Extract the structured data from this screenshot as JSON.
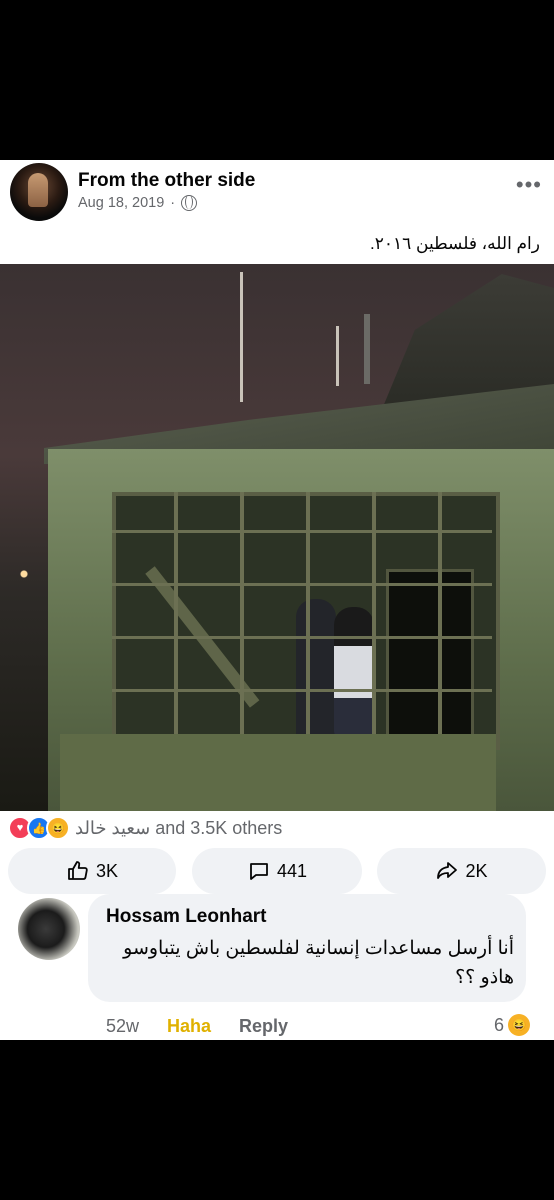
{
  "post": {
    "page_name": "From the other side",
    "date": "Aug 18, 2019",
    "separator": "·",
    "more": "•••",
    "caption": "رام الله، فلسطين ٢٠١٦."
  },
  "reactions": {
    "summary": "سعيد خالد and 3.5K others",
    "icons": [
      "love-icon",
      "like-icon",
      "haha-icon"
    ]
  },
  "actions": {
    "like": "3K",
    "comment": "441",
    "share": "2K"
  },
  "comment": {
    "author": "Hossam Leonhart",
    "text": "أنا أرسل مساعدات إنسانية لفلسطين باش يتباوسو هاذو ؟؟",
    "age": "52w",
    "haha_label": "Haha",
    "reply_label": "Reply",
    "reaction_count": "6"
  },
  "colors": {
    "meta": "#65676b",
    "button_bg": "#f0f2f5",
    "haha": "#e0b100"
  }
}
